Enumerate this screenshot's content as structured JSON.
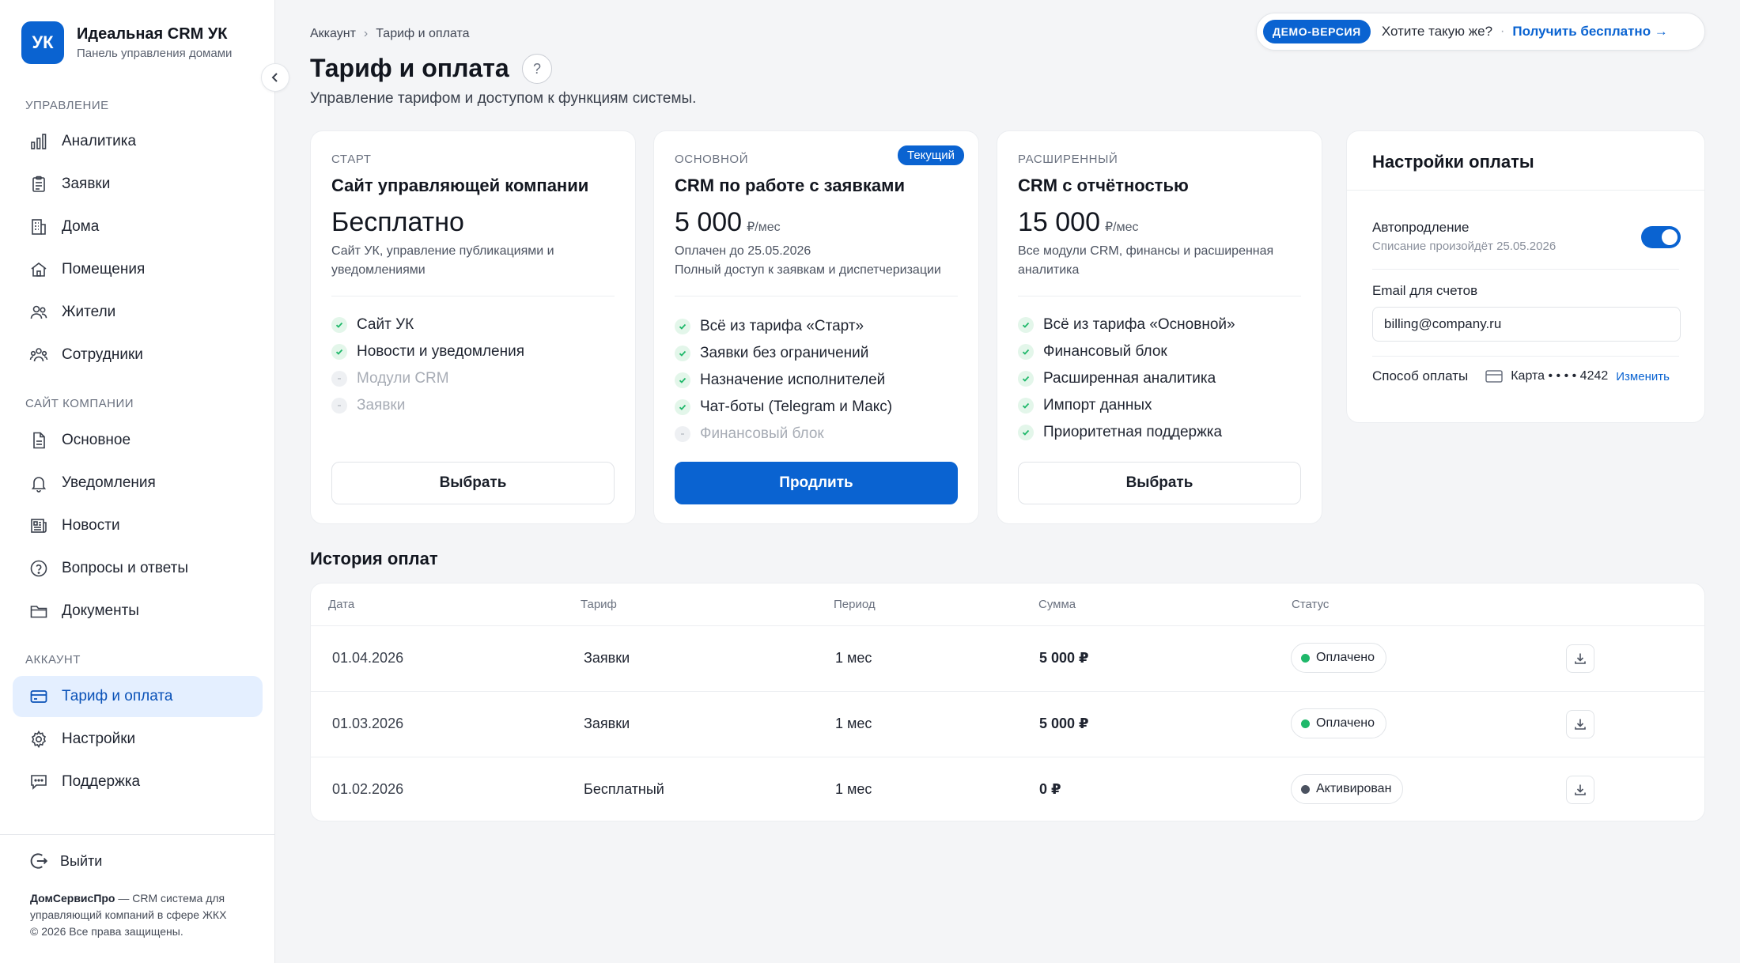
{
  "brand": {
    "logo_text": "УК",
    "title": "Идеальная CRM УК",
    "subtitle": "Панель управления домами"
  },
  "sidebar": {
    "sections": [
      {
        "label": "Управление"
      },
      {
        "label": "Сайт компании"
      },
      {
        "label": "Аккаунт"
      }
    ],
    "items": [
      {
        "label": "Аналитика",
        "icon": "bar-chart-icon"
      },
      {
        "label": "Заявки",
        "icon": "clipboard-icon"
      },
      {
        "label": "Дома",
        "icon": "building-icon"
      },
      {
        "label": "Помещения",
        "icon": "home-icon"
      },
      {
        "label": "Жители",
        "icon": "users-icon"
      },
      {
        "label": "Сотрудники",
        "icon": "team-icon"
      },
      {
        "label": "Основное",
        "icon": "document-icon"
      },
      {
        "label": "Уведомления",
        "icon": "bell-icon"
      },
      {
        "label": "Новости",
        "icon": "newspaper-icon"
      },
      {
        "label": "Вопросы и ответы",
        "icon": "question-icon"
      },
      {
        "label": "Документы",
        "icon": "folder-icon"
      },
      {
        "label": "Тариф и оплата",
        "icon": "credit-card-icon",
        "active": true
      },
      {
        "label": "Настройки",
        "icon": "gear-icon"
      },
      {
        "label": "Поддержка",
        "icon": "chat-icon"
      }
    ],
    "logout_label": "Выйти",
    "footer": {
      "brand": "ДомСервисПро",
      "text": " — CRM система для управляющий компаний в сфере ЖКХ",
      "copyright": "© 2026 Все права защищены."
    }
  },
  "breadcrumb": {
    "parent": "Аккаунт",
    "separator": "›",
    "current": "Тариф и оплата"
  },
  "page": {
    "title": "Тариф и оплата",
    "help": "?",
    "subtitle": "Управление тарифом и доступом к функциям системы."
  },
  "demo": {
    "badge": "ДЕМО-ВЕРСИЯ",
    "question": "Хотите такую же?",
    "dot": "·",
    "link": "Получить бесплатно →"
  },
  "plans": [
    {
      "tier": "Старт",
      "name": "Сайт управляющей компании",
      "price": "Бесплатно",
      "unit": "",
      "desc": "Сайт УК, управление публикациями и уведомлениями",
      "features": [
        {
          "text": "Сайт УК",
          "on": true
        },
        {
          "text": "Новости и уведомления",
          "on": true
        },
        {
          "text": "Модули CRM",
          "on": false
        },
        {
          "text": "Заявки",
          "on": false
        }
      ],
      "button": "Выбрать"
    },
    {
      "tier": "Основной",
      "badge": "Текущий",
      "name": "CRM по работе с заявками",
      "price": "5 000",
      "unit": "₽/мес",
      "desc": "Оплачен до 25.05.2026\nПолный доступ к заявкам и диспетчеризации",
      "features": [
        {
          "text": "Всё из тарифа «Старт»",
          "on": true
        },
        {
          "text": "Заявки без ограничений",
          "on": true
        },
        {
          "text": "Назначение исполнителей",
          "on": true
        },
        {
          "text": "Чат-боты (Telegram и Макс)",
          "on": true
        },
        {
          "text": "Финансовый блок",
          "on": false
        }
      ],
      "button": "Продлить"
    },
    {
      "tier": "Расширенный",
      "name": "CRM с отчётностью",
      "price": "15 000",
      "unit": "₽/мес",
      "desc": "Все модули CRM, финансы и расширенная аналитика",
      "features": [
        {
          "text": "Всё из тарифа «Основной»",
          "on": true
        },
        {
          "text": "Финансовый блок",
          "on": true
        },
        {
          "text": "Расширенная аналитика",
          "on": true
        },
        {
          "text": "Импорт данных",
          "on": true
        },
        {
          "text": "Приоритетная поддержка",
          "on": true
        }
      ],
      "button": "Выбрать"
    }
  ],
  "payment_settings": {
    "title": "Настройки оплаты",
    "autorenew_label": "Автопродление",
    "autorenew_sub": "Списание произойдёт 25.05.2026",
    "autorenew_on": true,
    "email_label": "Email для счетов",
    "email_value": "billing@company.ru",
    "method_label": "Способ оплаты",
    "method_value": "Карта • • • • 4242",
    "change_label": "Изменить"
  },
  "history": {
    "title": "История оплат",
    "columns": [
      "Дата",
      "Тариф",
      "Период",
      "Сумма",
      "Статус"
    ],
    "rows": [
      {
        "date": "01.04.2026",
        "plan": "Заявки",
        "period": "1 мес",
        "sum": "5 000 ₽",
        "status": "Оплачено",
        "status_color": "#1fb86a"
      },
      {
        "date": "01.03.2026",
        "plan": "Заявки",
        "period": "1 мес",
        "sum": "5 000 ₽",
        "status": "Оплачено",
        "status_color": "#1fb86a"
      },
      {
        "date": "01.02.2026",
        "plan": "Бесплатный",
        "period": "1 мес",
        "sum": "0 ₽",
        "status": "Активирован",
        "status_color": "#4b5260"
      }
    ]
  },
  "colors": {
    "accent": "#0a63d1",
    "active_bg": "#e4efff",
    "success": "#1fb86a"
  }
}
